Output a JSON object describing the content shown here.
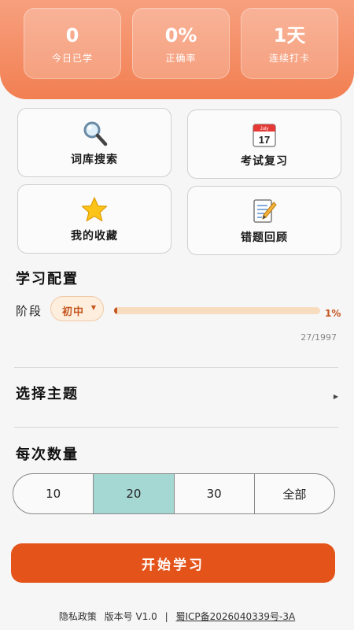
{
  "stats": [
    {
      "value": "0",
      "label": "今日已学"
    },
    {
      "value": "0%",
      "label": "正确率"
    },
    {
      "value": "1天",
      "label": "连续打卡"
    }
  ],
  "cards": [
    {
      "label": "词库搜索",
      "icon": "magnifier-icon"
    },
    {
      "label": "考试复习",
      "icon": "calendar-icon"
    },
    {
      "label": "我的收藏",
      "icon": "star-icon"
    },
    {
      "label": "错题回顾",
      "icon": "memo-icon"
    }
  ],
  "calendar_icon_text": {
    "month": "July",
    "day": "17"
  },
  "config": {
    "title": "学习配置",
    "stage_label": "阶段",
    "stage_value": "初中",
    "progress_percent_text": "1%",
    "progress_fraction": 0.0136,
    "progress_count": "27/1997"
  },
  "topic": {
    "label": "选择主题"
  },
  "quantity": {
    "title": "每次数量",
    "options": [
      "10",
      "20",
      "30",
      "全部"
    ],
    "selected": "20"
  },
  "start_button": "开始学习",
  "footer": {
    "privacy": "隐私政策",
    "version": "版本号 V1.0",
    "separator": "|",
    "icp": "蜀ICP备2026040339号-3A"
  },
  "colors": {
    "header": "#f27f52",
    "accent": "#e4541a",
    "progress": "#c5551d",
    "selected_segment": "#a6d8d3"
  }
}
